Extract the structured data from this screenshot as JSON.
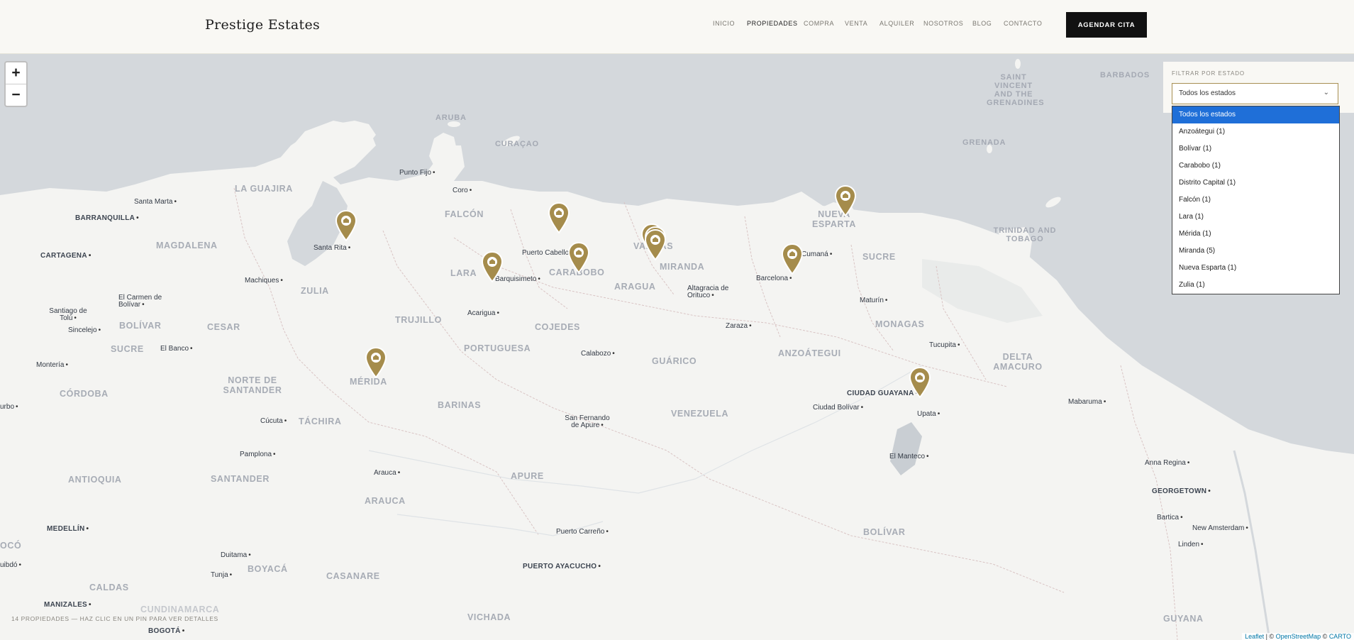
{
  "header": {
    "brand": "Prestige Estates",
    "nav": [
      "INICIO",
      "PROPIEDADES",
      "COMPRA",
      "VENTA",
      "ALQUILER",
      "NOSOTROS",
      "BLOG",
      "CONTACTO"
    ],
    "active_nav": "PROPIEDADES",
    "cta": "AGENDAR CITA"
  },
  "filter": {
    "label": "FILTRAR POR ESTADO",
    "selected": "Todos los estados",
    "options": [
      "Todos los estados",
      "Anzoátegui (1)",
      "Bolívar (1)",
      "Carabobo (1)",
      "Distrito Capital (1)",
      "Falcón (1)",
      "Lara (1)",
      "Mérida (1)",
      "Miranda (5)",
      "Nueva Esparta (1)",
      "Zulia (1)"
    ]
  },
  "map": {
    "zoom_in": "+",
    "zoom_out": "−",
    "footer_note": "14 PROPIEDADES — HAZ CLIC EN UN PIN PARA VER DETALLES",
    "attribution": {
      "leaflet": "Leaflet",
      "sep": " | © ",
      "osm": "OpenStreetMap",
      "sep2": " © ",
      "carto": "CARTO"
    },
    "labels": {
      "aruba": "ARUBA",
      "curacao": "CURAÇAO",
      "barbados": "BARBADOS",
      "saint_vincent": "SAINT VINCENT AND THE GRENADINES",
      "grenada": "GRENADA",
      "trinidad": "TRINIDAD AND TOBAGO",
      "la_guajira": "LA GUAJIRA",
      "magdalena": "MAGDALENA",
      "zulia": "ZULIA",
      "falcon": "FALCÓN",
      "lara": "LARA",
      "carabobo": "CARABOBO",
      "aragua": "ARAGUA",
      "miranda": "MIRANDA",
      "vargas": "VARGAS",
      "nueva_esparta": "NUEVA ESPARTA",
      "sucre_ve": "SUCRE",
      "monagas": "MONAGAS",
      "delta_amacuro": "DELTA AMACURO",
      "anzoategui": "ANZOÁTEGUI",
      "guarico": "GUÁRICO",
      "cojedes": "COJEDES",
      "portuguesa": "PORTUGUESA",
      "trujillo": "TRUJILLO",
      "barinas": "BARINAS",
      "merida": "MÉRIDA",
      "tachira": "TÁCHIRA",
      "norte_santander": "NORTE DE SANTANDER",
      "cesar": "CESAR",
      "bolivar_co": "BOLÍVAR",
      "sucre_co": "SUCRE",
      "cordoba": "CÓRDOBA",
      "antioquia": "ANTIOQUIA",
      "santander": "SANTANDER",
      "arauca": "ARAUCA",
      "apure": "APURE",
      "venezuela": "VENEZUELA",
      "bolivar_ve": "BOLÍVAR",
      "casanare": "CASANARE",
      "boyaca": "BOYACÁ",
      "caldas": "CALDAS",
      "vichada": "VICHADA",
      "guyana": "GUYANA",
      "cundinamarca": "CUNDINAMARCA",
      "barranquilla": "BARRANQUILLA",
      "cartagena": "CARTAGENA",
      "santa_marta": "Santa Marta",
      "punto_fijo": "Punto Fijo",
      "coro": "Coro",
      "santa_rita": "Santa Rita",
      "machiques": "Machiques",
      "el_carmen": "El Carmen de Bolívar",
      "santiago_tolu": "Santiago de Tolú",
      "sincelejo": "Sincelejo",
      "el_banco": "El Banco",
      "monteria": "Montería",
      "barquisimeto": "Barquisimeto",
      "puerto_cabello": "Puerto Cabello",
      "acarigua": "Acarigua",
      "altagracia": "Altagracia de Orituco",
      "barcelona": "Barcelona",
      "cumana": "Cumaná",
      "maturin": "Maturín",
      "zaraza": "Zaraza",
      "calabozo": "Calabozo",
      "tucupita": "Tucupita",
      "ciudad_guayana": "CIUDAD GUAYANA",
      "ciudad_bolivar": "Ciudad Bolívar",
      "upata": "Upata",
      "el_manteco": "El Manteco",
      "mabaruma": "Mabaruma",
      "san_fernando": "San Fernando de Apure",
      "cucuta": "Cúcuta",
      "pamplona": "Pamplona",
      "arauca_city": "Arauca",
      "medellin": "MEDELLÍN",
      "duitama": "Duitama",
      "tunja": "Tunja",
      "puerto_carreno": "Puerto Carreño",
      "puerto_ayacucho": "PUERTO AYACUCHO",
      "manizales": "MANIZALES",
      "bogota": "BOGOTÁ",
      "anna_regina": "Anna Regina",
      "georgetown": "GEORGETOWN",
      "bartica": "Bartica",
      "new_amsterdam": "New Amsterdam",
      "linden": "Linden",
      "turbo": "urbo",
      "quibdo": "uibdó",
      "choco": "OCÓ"
    }
  }
}
